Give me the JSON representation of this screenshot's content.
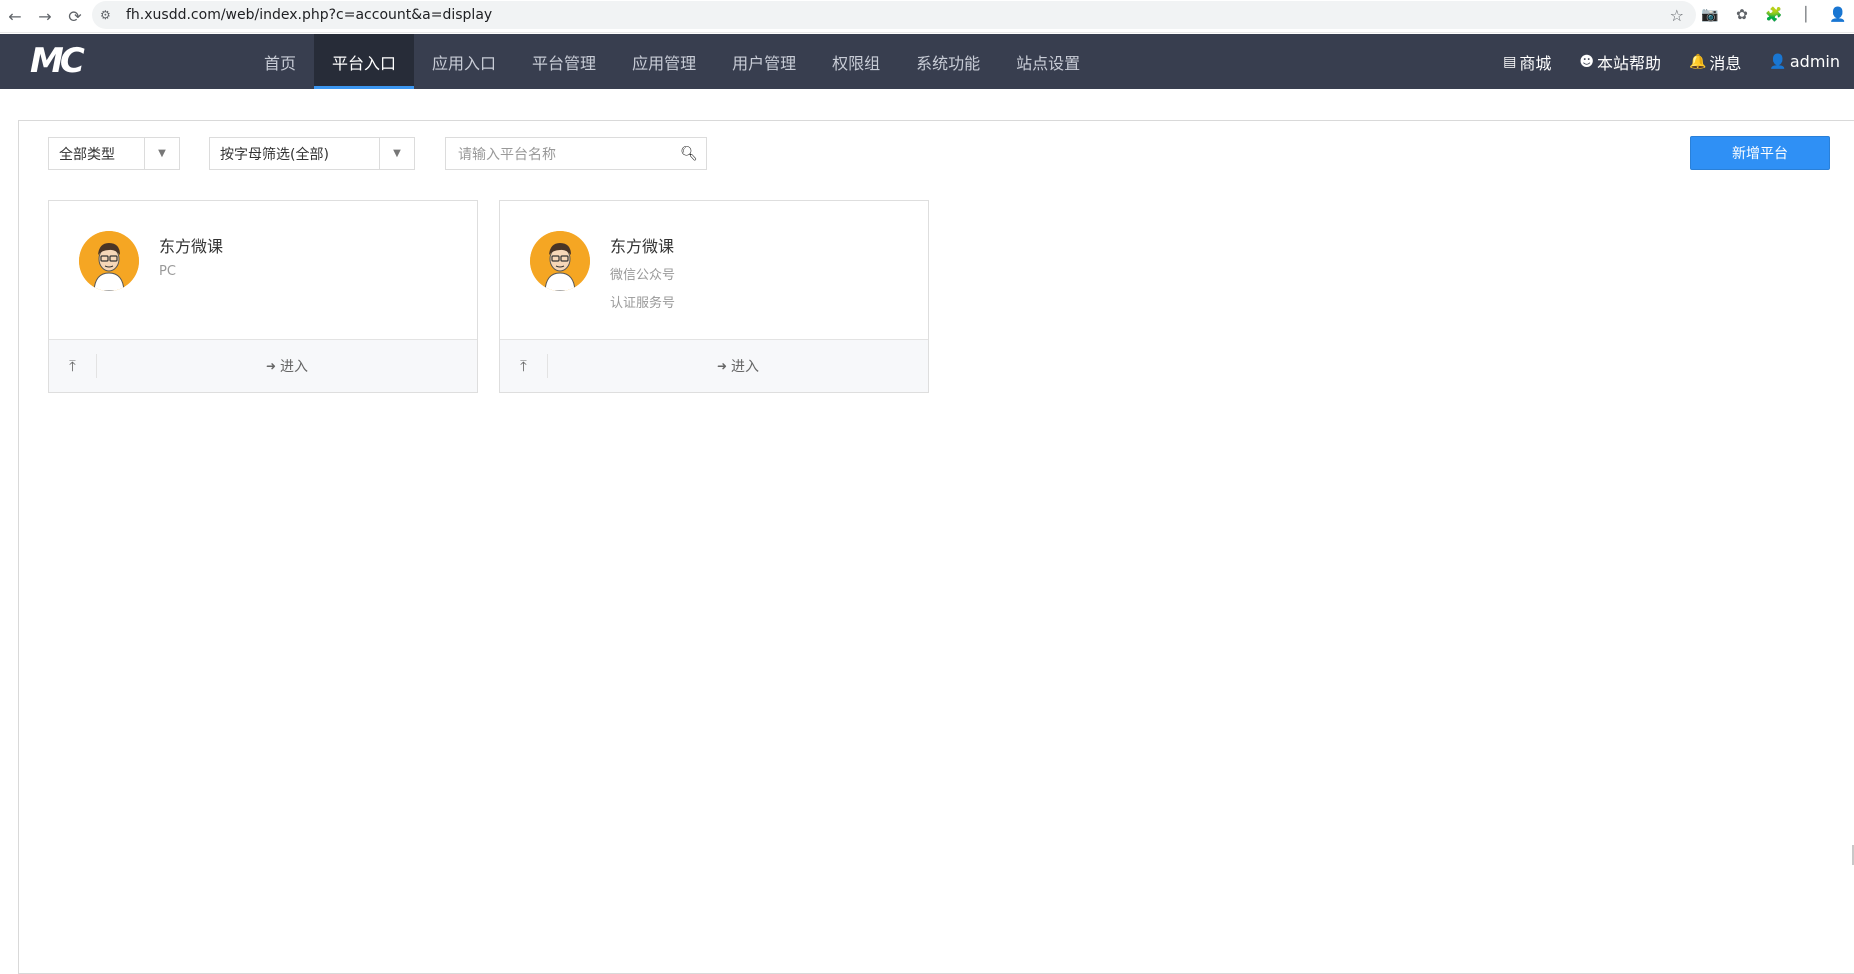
{
  "browser": {
    "url": "fh.xusdd.com/web/index.php?c=account&a=display",
    "back_icon": "←",
    "forward_icon": "→",
    "reload_icon": "⟳",
    "site_info_icon": "⚙",
    "star_icon": "☆",
    "ext_icons": [
      "📷",
      "✿",
      "🧩",
      "│",
      "👤"
    ]
  },
  "app": {
    "logo_text": "MC",
    "nav": [
      {
        "label": "首页"
      },
      {
        "label": "平台入口",
        "active": true
      },
      {
        "label": "应用入口"
      },
      {
        "label": "平台管理"
      },
      {
        "label": "应用管理"
      },
      {
        "label": "用户管理"
      },
      {
        "label": "权限组"
      },
      {
        "label": "系统功能"
      },
      {
        "label": "站点设置"
      }
    ],
    "right": {
      "shop": "商城",
      "help": "本站帮助",
      "messages": "消息",
      "user": "admin"
    }
  },
  "filters": {
    "type_value": "全部类型",
    "letter_value": "按字母筛选(全部)",
    "search_placeholder": "请输入平台名称",
    "add_button": "新增平台"
  },
  "cards": [
    {
      "name": "东方微课",
      "sub1": "PC",
      "sub2": "",
      "enter": "进入"
    },
    {
      "name": "东方微课",
      "sub1": "微信公众号",
      "sub2": "认证服务号",
      "enter": "进入"
    }
  ],
  "colors": {
    "topnav_bg": "#383e4f",
    "active_bg": "#272c38",
    "accent": "#3b96f0",
    "button": "#2f90f5",
    "avatar_bg": "#f5a623"
  }
}
